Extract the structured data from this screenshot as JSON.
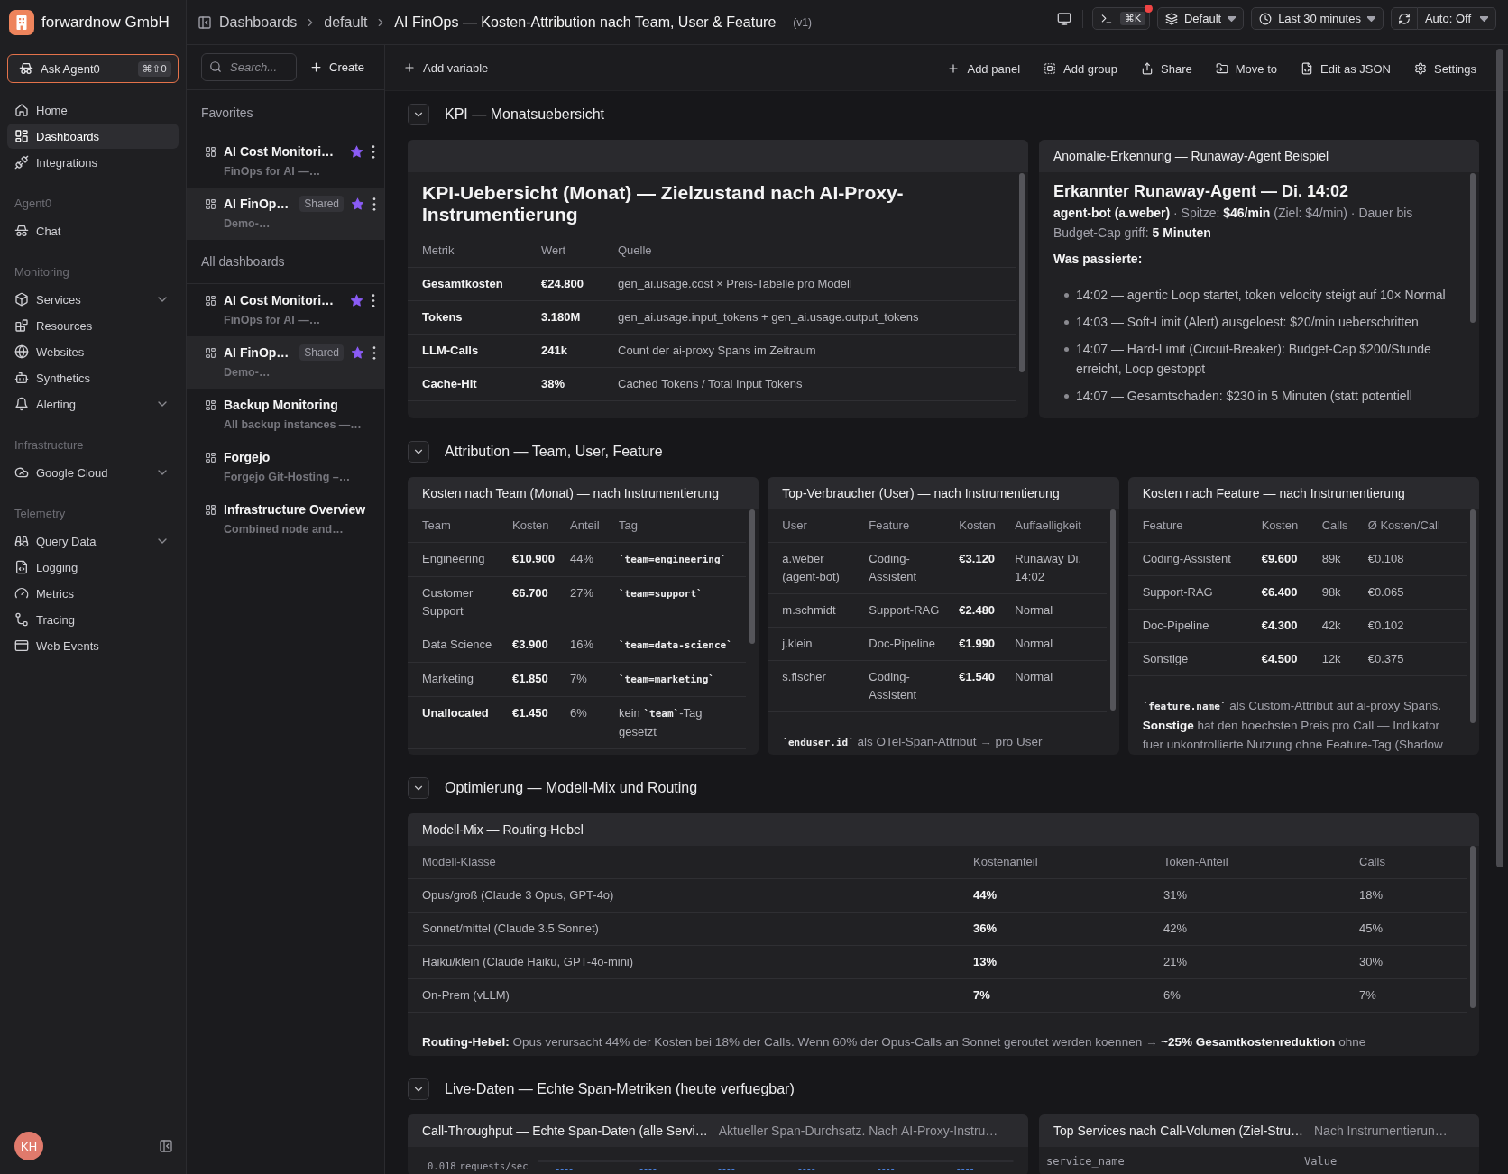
{
  "sidebar": {
    "org_name": "forwardnow GmbH",
    "ask_button": {
      "label": "Ask Agent0",
      "shortcut": "⌘⇧0"
    },
    "groups": [
      {
        "items": [
          {
            "label": "Home",
            "kind": "link",
            "selected": false
          },
          {
            "label": "Dashboards",
            "kind": "link",
            "selected": true
          },
          {
            "label": "Integrations",
            "kind": "link",
            "selected": false
          }
        ]
      },
      {
        "title": "Agent0",
        "items": [
          {
            "label": "Chat",
            "kind": "link",
            "selected": false
          }
        ]
      },
      {
        "title": "Monitoring",
        "items": [
          {
            "label": "Services",
            "kind": "group",
            "selected": false
          },
          {
            "label": "Resources",
            "kind": "link",
            "selected": false
          },
          {
            "label": "Websites",
            "kind": "link",
            "selected": false
          },
          {
            "label": "Synthetics",
            "kind": "link",
            "selected": false
          },
          {
            "label": "Alerting",
            "kind": "group",
            "selected": false
          }
        ]
      },
      {
        "title": "Infrastructure",
        "items": [
          {
            "label": "Google Cloud",
            "kind": "group",
            "selected": false
          }
        ]
      },
      {
        "title": "Telemetry",
        "items": [
          {
            "label": "Query Data",
            "kind": "group",
            "selected": false
          },
          {
            "label": "Logging",
            "kind": "link",
            "selected": false
          },
          {
            "label": "Metrics",
            "kind": "link",
            "selected": false
          },
          {
            "label": "Tracing",
            "kind": "link",
            "selected": false
          },
          {
            "label": "Web Events",
            "kind": "link",
            "selected": false
          }
        ]
      }
    ],
    "user_initials": "KH"
  },
  "top_bar": {
    "breadcrumbs": [
      "Dashboards",
      "default"
    ],
    "title": "AI FinOps — Kosten-Attribution nach Team, User & Feature",
    "version": "(v1)",
    "command": {
      "shortcut": "⌘K",
      "alert": true
    },
    "environment": "Default",
    "time_range": "Last 30 minutes",
    "auto_refresh": "Auto: Off"
  },
  "dashboard_list": {
    "search": {
      "placeholder": "Search..."
    },
    "create_label": "Create",
    "sections": [
      {
        "title": "Favorites",
        "items": [
          {
            "title": "AI Cost Monitori…",
            "subtitle": "FinOps for AI —…",
            "starred": true,
            "menu": true,
            "selected": false
          },
          {
            "title": "AI FinOp…",
            "badge": "Shared",
            "subtitle": "Demo-…",
            "starred": true,
            "menu": true,
            "selected": true
          }
        ]
      },
      {
        "title": "All dashboards",
        "items": [
          {
            "title": "AI Cost Monitori…",
            "subtitle": "FinOps for AI —…",
            "starred": true,
            "menu": true,
            "selected": false
          },
          {
            "title": "AI FinOp…",
            "badge": "Shared",
            "subtitle": "Demo-…",
            "starred": true,
            "menu": true,
            "selected": true
          },
          {
            "title": "Backup Monitoring",
            "subtitle": "All backup instances —…",
            "starred": false,
            "menu": false,
            "selected": false
          },
          {
            "title": "Forgejo",
            "subtitle": "Forgejo Git-Hosting –…",
            "starred": false,
            "menu": false,
            "selected": false
          },
          {
            "title": "Infrastructure Overview",
            "subtitle": "Combined node and…",
            "starred": false,
            "menu": false,
            "selected": false
          }
        ]
      }
    ]
  },
  "toolbar": {
    "add_variable": "Add variable",
    "actions": [
      "Add panel",
      "Add group",
      "Share",
      "Move to",
      "Edit as JSON",
      "Settings"
    ]
  },
  "sections": [
    {
      "title": "KPI — Monatsuebersicht",
      "expanded": true,
      "panels": [
        {
          "blocks": [
            {
              "kind": "title",
              "text": "KPI-Uebersicht (Monat) — Zielzustand nach AI-Proxy-Instrumentierung"
            },
            {
              "kind": "table",
              "columns": [
                {
                  "label": "Metrik",
                  "strong": true
                },
                {
                  "label": "Wert",
                  "strong": true
                },
                {
                  "label": "Quelle",
                  "strong": false
                }
              ],
              "rows": [
                {
                  "cells": [
                    "Gesamtkosten",
                    "€24.800",
                    "gen_ai.usage.cost × Preis-Tabelle pro Modell"
                  ]
                },
                {
                  "cells": [
                    "Tokens",
                    "3.180M",
                    "gen_ai.usage.input_tokens + gen_ai.usage.output_tokens"
                  ]
                },
                {
                  "cells": [
                    "LLM-Calls",
                    "241k",
                    "Count der ai-proxy Spans im Zeitraum"
                  ]
                },
                {
                  "cells": [
                    "Cache-Hit",
                    "38%",
                    "Cached Tokens / Total Input Tokens"
                  ]
                }
              ]
            }
          ]
        },
        {
          "title": "Anomalie-Erkennung — Runaway-Agent Beispiel",
          "blocks": [
            {
              "kind": "heading",
              "text": "Erkannter Runaway-Agent — Di. 14:02"
            },
            {
              "kind": "paragraph",
              "parts": [
                {
                  "kind": "text",
                  "text": "**agent-bot (a.weber)** · Spitze: **$46/min** (Ziel: $4/min) · Dauer bis Budget-Cap griff: **5 Minuten**"
                }
              ]
            },
            {
              "kind": "label",
              "text": "Was passierte:"
            },
            {
              "kind": "list",
              "items": [
                "14:02 — agentic Loop startet, token velocity steigt auf 10× Normal",
                "14:03 — Soft-Limit (Alert) ausgeloest: $20/min ueberschritten",
                "14:07 — Hard-Limit (Circuit-Breaker): Budget-Cap $200/Stunde erreicht, Loop gestoppt",
                "14:07 — Gesamtschaden: $230 in 5 Minuten (statt potentiell"
              ]
            }
          ]
        }
      ]
    },
    {
      "title": "Attribution — Team, User, Feature",
      "expanded": true,
      "panels": [
        {
          "title": "Kosten nach Team (Monat) — nach Instrumentierung",
          "blocks": [
            {
              "kind": "table",
              "columns": [
                {
                  "label": "Team",
                  "strong": false
                },
                {
                  "label": "Kosten",
                  "strong": true
                },
                {
                  "label": "Anteil",
                  "strong": false
                },
                {
                  "label": "Tag",
                  "strong": false
                }
              ],
              "rows": [
                {
                  "cells": [
                    "Engineering",
                    "€10.900",
                    "44%",
                    [
                      {
                        "kind": "code",
                        "text": "`team=engineering`"
                      }
                    ]
                  ],
                  "emphasized": false
                },
                {
                  "cells": [
                    "Customer Support",
                    "€6.700",
                    "27%",
                    [
                      {
                        "kind": "code",
                        "text": "`team=support`"
                      }
                    ]
                  ],
                  "emphasized": false
                },
                {
                  "cells": [
                    "Data Science",
                    "€3.900",
                    "16%",
                    [
                      {
                        "kind": "code",
                        "text": "`team=data-science`"
                      }
                    ]
                  ],
                  "emphasized": false
                },
                {
                  "cells": [
                    "Marketing",
                    "€1.850",
                    "7%",
                    [
                      {
                        "kind": "code",
                        "text": "`team=marketing`"
                      }
                    ]
                  ],
                  "emphasized": false
                },
                {
                  "cells": [
                    "Unallocated",
                    "€1.450",
                    "6%",
                    [
                      {
                        "kind": "text",
                        "text": "kein "
                      },
                      {
                        "kind": "code",
                        "text": "`team`"
                      },
                      {
                        "kind": "text",
                        "text": "-Tag gesetzt"
                      }
                    ]
                  ],
                  "emphasized": true
                }
              ]
            }
          ]
        },
        {
          "title": "Top-Verbraucher (User) — nach Instrumentierung",
          "blocks": [
            {
              "kind": "table",
              "columns": [
                {
                  "label": "User",
                  "strong": false
                },
                {
                  "label": "Feature",
                  "strong": false
                },
                {
                  "label": "Kosten",
                  "strong": true
                },
                {
                  "label": "Auffaelligkeit",
                  "strong": false
                }
              ],
              "rows": [
                {
                  "cells": [
                    "a.weber (agent-bot)",
                    "Coding-Assistent",
                    "€3.120",
                    "Runaway Di. 14:02"
                  ]
                },
                {
                  "cells": [
                    "m.schmidt",
                    "Support-RAG",
                    "€2.480",
                    "Normal"
                  ]
                },
                {
                  "cells": [
                    "j.klein",
                    "Doc-Pipeline",
                    "€1.990",
                    "Normal"
                  ]
                },
                {
                  "cells": [
                    "s.fischer",
                    "Coding-Assistent",
                    "€1.540",
                    "Normal"
                  ]
                }
              ]
            },
            {
              "kind": "paragraph",
              "parts": [
                {
                  "kind": "code",
                  "text": "`enduser.id`"
                },
                {
                  "kind": "text",
                  "text": " als OTel-Span-Attribut → pro User"
                }
              ]
            }
          ]
        },
        {
          "title": "Kosten nach Feature — nach Instrumentierung",
          "blocks": [
            {
              "kind": "table",
              "columns": [
                {
                  "label": "Feature",
                  "strong": false
                },
                {
                  "label": "Kosten",
                  "strong": true
                },
                {
                  "label": "Calls",
                  "strong": false
                },
                {
                  "label": "Ø Kosten/Call",
                  "strong": false
                }
              ],
              "rows": [
                {
                  "cells": [
                    "Coding-Assistent",
                    "€9.600",
                    "89k",
                    "€0.108"
                  ]
                },
                {
                  "cells": [
                    "Support-RAG",
                    "€6.400",
                    "98k",
                    "€0.065"
                  ]
                },
                {
                  "cells": [
                    "Doc-Pipeline",
                    "€4.300",
                    "42k",
                    "€0.102"
                  ]
                },
                {
                  "cells": [
                    "Sonstige",
                    "€4.500",
                    "12k",
                    "€0.375"
                  ]
                }
              ]
            },
            {
              "kind": "paragraph",
              "parts": [
                {
                  "kind": "code",
                  "text": "`feature.name`"
                },
                {
                  "kind": "text",
                  "text": " als Custom-Attribut auf ai-proxy Spans. **Sonstige** hat den hoechsten Preis pro Call — Indikator fuer unkontrollierte Nutzung ohne Feature-Tag (Shadow"
                }
              ]
            }
          ]
        }
      ]
    },
    {
      "title": "Optimierung — Modell-Mix und Routing",
      "expanded": true,
      "panels": [
        {
          "title": "Modell-Mix — Routing-Hebel",
          "blocks": [
            {
              "kind": "table",
              "columns": [
                {
                  "label": "Modell-Klasse",
                  "strong": false
                },
                {
                  "label": "Kostenanteil",
                  "strong": true
                },
                {
                  "label": "Token-Anteil",
                  "strong": false
                },
                {
                  "label": "Calls",
                  "strong": false
                }
              ],
              "rows": [
                {
                  "cells": [
                    "Opus/groß (Claude 3 Opus, GPT-4o)",
                    "44%",
                    "31%",
                    "18%"
                  ]
                },
                {
                  "cells": [
                    "Sonnet/mittel (Claude 3.5 Sonnet)",
                    "36%",
                    "42%",
                    "45%"
                  ]
                },
                {
                  "cells": [
                    "Haiku/klein (Claude Haiku, GPT-4o-mini)",
                    "13%",
                    "21%",
                    "30%"
                  ]
                },
                {
                  "cells": [
                    "On-Prem (vLLM)",
                    "7%",
                    "6%",
                    "7%"
                  ]
                }
              ]
            },
            {
              "kind": "paragraph",
              "parts": [
                {
                  "kind": "text",
                  "text": "**Routing-Hebel:** Opus verursacht 44% der Kosten bei 18% der Calls. Wenn 60% der Opus-Calls an Sonnet geroutet werden koennen → **~25% Gesamtkostenreduktion** ohne"
                }
              ]
            }
          ]
        }
      ]
    },
    {
      "title": "Live-Daten — Echte Span-Metriken (heute verfuegbar)",
      "expanded": true,
      "panels": [
        {
          "title": "Call-Throughput — Echte Span-Daten (alle Servi…",
          "description": "Aktueller Span-Durchsatz. Nach AI-Proxy-Instru…",
          "blocks": [
            {
              "kind": "chart",
              "y_tick": "0.018",
              "y_unit": "requests/sec"
            }
          ]
        },
        {
          "title": "Top Services nach Call-Volumen (Ziel-Stru…",
          "description": "Nach Instrumentierun…",
          "blocks": [
            {
              "kind": "columns",
              "labels": [
                "service_name",
                "Value"
              ]
            }
          ]
        }
      ]
    }
  ]
}
